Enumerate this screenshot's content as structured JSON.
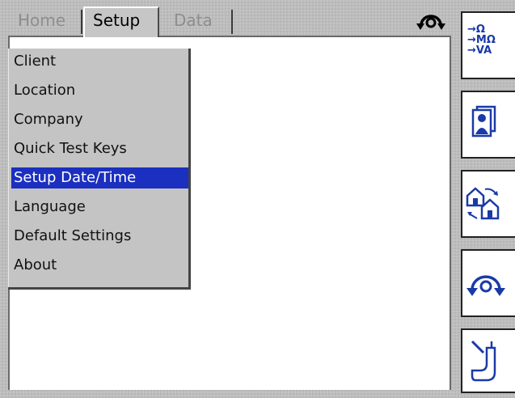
{
  "tabs": [
    {
      "label": "Home",
      "active": false
    },
    {
      "label": "Setup",
      "active": true
    },
    {
      "label": "Data",
      "active": false
    }
  ],
  "status_icon": "rotate-arrows-icon",
  "setup_menu": {
    "items": [
      {
        "label": "Client"
      },
      {
        "label": "Location"
      },
      {
        "label": "Company"
      },
      {
        "label": "Quick Test Keys"
      },
      {
        "label": "Setup Date/Time",
        "selected": true
      },
      {
        "label": "Language"
      },
      {
        "label": "Default Settings"
      },
      {
        "label": "About"
      }
    ]
  },
  "side_buttons": {
    "ranges": {
      "line1": "→Ω",
      "line2": "→MΩ",
      "line3": "→VA"
    },
    "icons": [
      "client-profile-icon",
      "location-transfer-icon",
      "rotate-arrows-icon",
      "probe-icon"
    ]
  },
  "colors": {
    "selection": "#1b2fc0",
    "icon_blue": "#1a3aa8",
    "background": "#bdbdbd"
  }
}
